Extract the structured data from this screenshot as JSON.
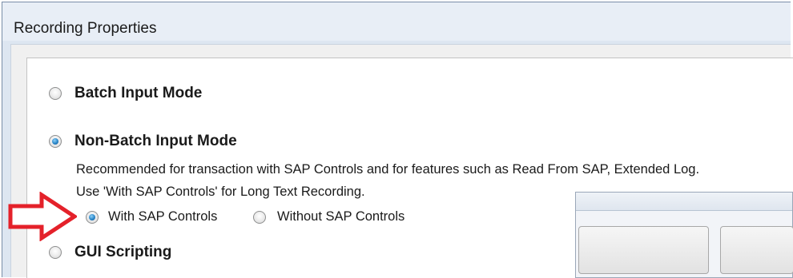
{
  "window": {
    "title": "Recording Properties"
  },
  "options": {
    "batch_input": {
      "label": "Batch Input Mode",
      "selected": false
    },
    "non_batch_input": {
      "label": "Non-Batch Input Mode",
      "selected": true,
      "description_line1": "Recommended for transaction with SAP Controls and for features such as Read From SAP, Extended Log.",
      "description_line2": "Use 'With SAP Controls' for Long Text Recording.",
      "sub_options": {
        "with_sap_controls": {
          "label": "With SAP Controls",
          "selected": true
        },
        "without_sap_controls": {
          "label": "Without SAP Controls",
          "selected": false
        }
      }
    },
    "gui_scripting": {
      "label": "GUI Scripting",
      "selected": false
    }
  },
  "colors": {
    "highlight_arrow": "#e4212a",
    "radio_dot": "#2a86c8"
  },
  "icons": {
    "annotation": "red-arrow-right-icon"
  }
}
